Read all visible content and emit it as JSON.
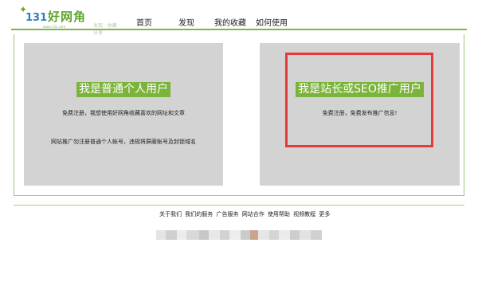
{
  "header": {
    "logo": {
      "number": "131",
      "name": "好网角",
      "subtitle": "www.131.com",
      "slogan": "发现 · 收藏 · 分享"
    },
    "nav": [
      {
        "label": "首页"
      },
      {
        "label": "发现"
      },
      {
        "label": "我的收藏"
      },
      {
        "label": "如何使用"
      }
    ]
  },
  "cards": {
    "personal": {
      "title": "我是普通个人用户",
      "desc": "免费注册，我想使用好网角收藏喜欢的网址和文章",
      "note": "网站推广勿注册普通个人帐号，违规将屏蔽帐号及封锁域名"
    },
    "webmaster": {
      "title": "我是站长或SEO推广用户",
      "desc": "免费注册，免费发布推广信息!"
    }
  },
  "footer": {
    "links": [
      {
        "label": "关于我们"
      },
      {
        "label": "我们的服务"
      },
      {
        "label": "广告服务"
      },
      {
        "label": "网站合作"
      },
      {
        "label": "使用帮助"
      },
      {
        "label": "视频教程"
      },
      {
        "label": "更多"
      }
    ]
  },
  "colors": {
    "accent_green": "#7bb43a",
    "card_gray": "#d3d3d3",
    "highlight_red": "#e53a3a"
  }
}
